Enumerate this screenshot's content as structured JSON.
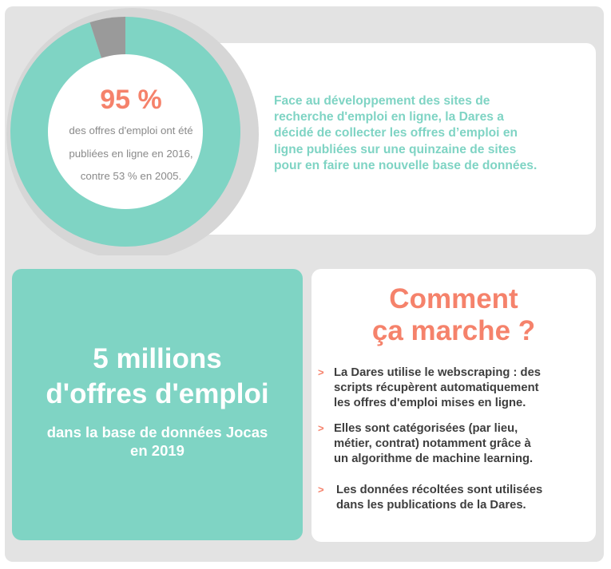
{
  "donut": {
    "share_online_percent": 95,
    "colors": {
      "online": "#7fd4c4",
      "other": "#9a9a9a",
      "track": "#d6d6d6"
    }
  },
  "stat": {
    "percent_label": "95 %",
    "caption_lines": [
      "des offres d'emploi ont été",
      "publiées en ligne en 2016,",
      "contre 53 % en 2005."
    ]
  },
  "intro": {
    "text_lines": [
      "Face au développement des sites de",
      "recherche d'emploi en ligne, la Dares a",
      "décidé de collecter les offres d’emploi en",
      "ligne publiées sur une quinzaine de sites",
      "pour en faire une nouvelle base de données."
    ]
  },
  "highlight": {
    "headline_lines": [
      "5 millions",
      "d'offres d'emploi"
    ],
    "subline_lines": [
      "dans la base de données Jocas",
      "en 2019"
    ]
  },
  "how": {
    "title_lines": [
      "Comment",
      "ça marche ?"
    ],
    "bullet_glyph": ">",
    "items": [
      [
        "La Dares utilise le webscraping : des",
        "scripts récupèrent automatiquement",
        "les offres d'emploi mises en ligne."
      ],
      [
        "Elles sont catégorisées (par lieu,",
        "métier, contrat) notamment grâce à",
        "un algorithme de machine learning."
      ],
      [
        "Les données récoltées sont utilisées",
        "dans les publications de la Dares."
      ]
    ]
  },
  "colors": {
    "teal": "#7fd4c4",
    "coral": "#f5826b",
    "gray_bg": "#e3e3e3",
    "dark_text": "#3e3e3e",
    "caption_gray": "#8a8a8a"
  }
}
